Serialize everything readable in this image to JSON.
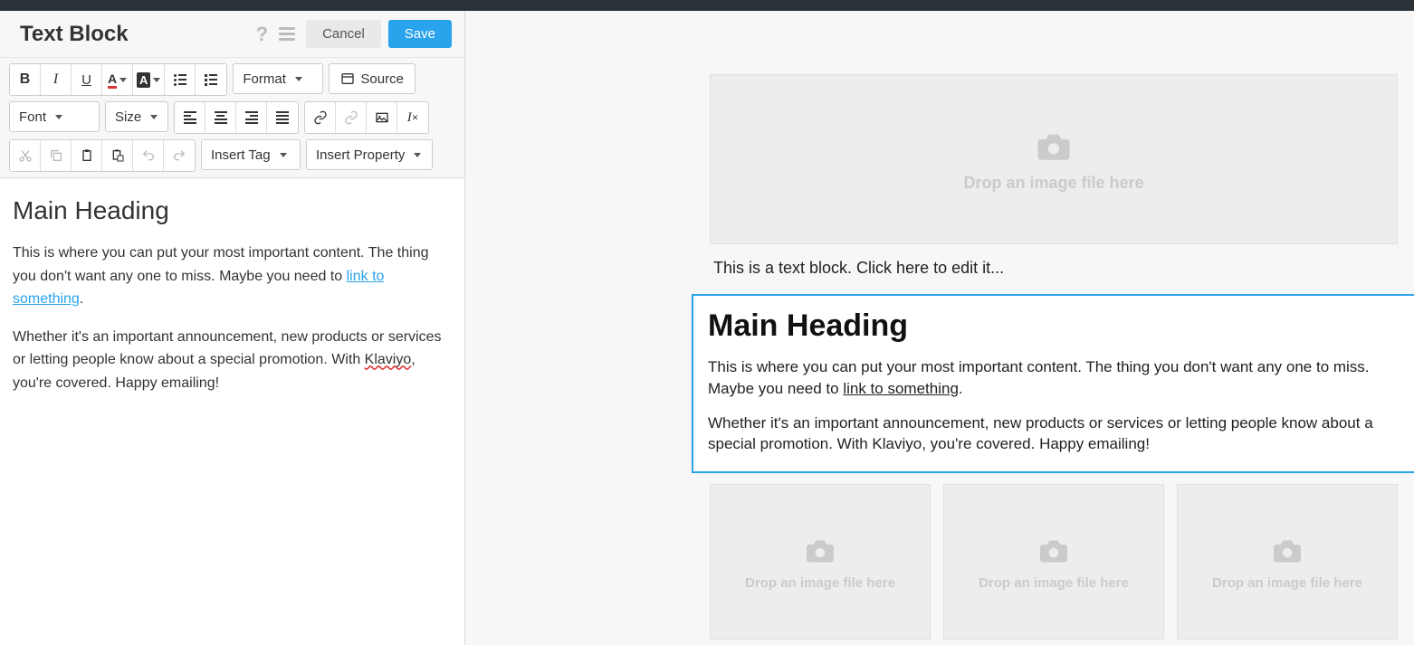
{
  "header": {
    "title": "Text Block",
    "cancel": "Cancel",
    "save": "Save"
  },
  "toolbar": {
    "format": "Format",
    "source": "Source",
    "font": "Font",
    "size": "Size",
    "insert_tag": "Insert Tag",
    "insert_property": "Insert Property"
  },
  "editor": {
    "heading": "Main Heading",
    "p1a": "This is where you can put your most important content. The thing you don't want any one to miss. Maybe you need to ",
    "p1_link": "link to something",
    "p1b": ".",
    "p2a": "Whether it's an important announcement, new products or services or letting people know about a special promotion. With ",
    "p2_k": "Klaviyo",
    "p2b": ", you're covered. Happy emailing!"
  },
  "preview": {
    "drop_text": "Drop an image file here",
    "hint": "This is a text block. Click here to edit it...",
    "heading": "Main Heading",
    "p1a": "This is where you can put your most important content. The thing you don't want any one to miss. Maybe you need to ",
    "p1_link": "link to something",
    "p1b": ".",
    "p2": "Whether it's an important announcement, new products or services or letting people know about a special promotion. With Klaviyo, you're covered. Happy emailing!"
  }
}
